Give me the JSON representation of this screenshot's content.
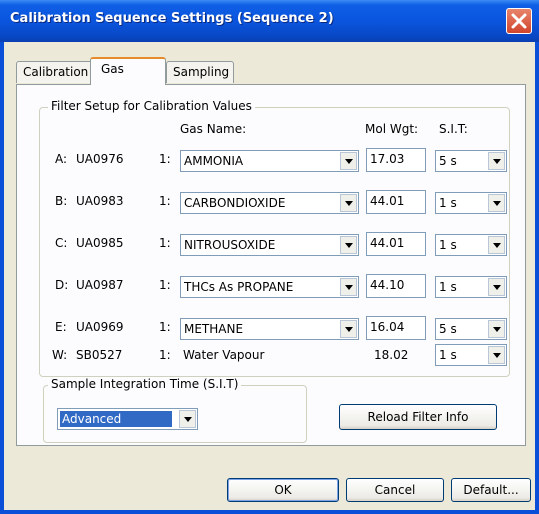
{
  "window": {
    "title": "Calibration Sequence Settings (Sequence 2)"
  },
  "tabs": [
    {
      "label": "Calibration"
    },
    {
      "label": "Gas"
    },
    {
      "label": "Sampling"
    }
  ],
  "filter_setup": {
    "title": "Filter Setup for Calibration Values",
    "headers": {
      "gas_name": "Gas Name:",
      "mol_wgt": "Mol Wgt:",
      "sit": "S.I.T:"
    },
    "rows": [
      {
        "id": "A:",
        "code": "UA0976",
        "ratio": "1:",
        "gas": "AMMONIA",
        "mol_wgt": "17.03",
        "sit": "5 s"
      },
      {
        "id": "B:",
        "code": "UA0983",
        "ratio": "1:",
        "gas": "CARBONDIOXIDE",
        "mol_wgt": "44.01",
        "sit": "1 s"
      },
      {
        "id": "C:",
        "code": "UA0985",
        "ratio": "1:",
        "gas": "NITROUSOXIDE",
        "mol_wgt": "44.01",
        "sit": "1 s"
      },
      {
        "id": "D:",
        "code": "UA0987",
        "ratio": "1:",
        "gas": "THCs As PROPANE",
        "mol_wgt": "44.10",
        "sit": "1 s"
      },
      {
        "id": "E:",
        "code": "UA0969",
        "ratio": "1:",
        "gas": "METHANE",
        "mol_wgt": "16.04",
        "sit": "5 s"
      }
    ],
    "water": {
      "id": "W:",
      "code": "SB0527",
      "ratio": "1:",
      "gas": "Water Vapour",
      "mol_wgt": "18.02",
      "sit": "1 s"
    }
  },
  "sit_group": {
    "title": "Sample Integration Time (S.I.T)",
    "selected": "Advanced"
  },
  "buttons": {
    "reload": "Reload Filter Info",
    "ok": "OK",
    "cancel": "Cancel",
    "default": "Default..."
  }
}
